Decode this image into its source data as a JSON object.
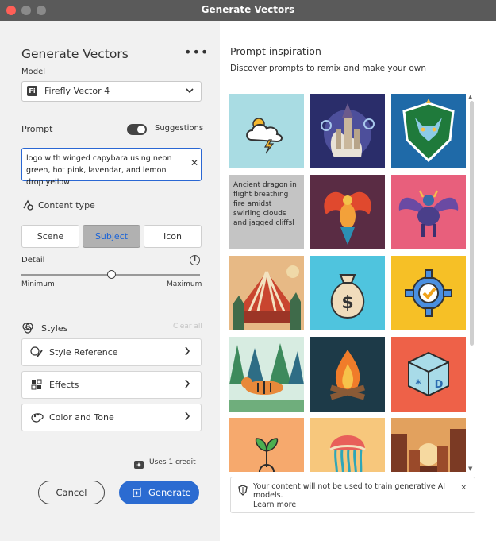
{
  "window": {
    "title": "Generate Vectors"
  },
  "panel": {
    "title": "Generate Vectors",
    "more_label": "•••",
    "model": {
      "label": "Model",
      "badge": "Fi",
      "value": "Firefly Vector 4"
    },
    "prompt": {
      "label": "Prompt",
      "suggestions_label": "Suggestions",
      "suggestions_enabled": true,
      "value": "logo with winged capybara using neon green, hot pink, lavendar, and lemon drop yellow"
    },
    "content_type": {
      "label": "Content type",
      "options": [
        "Scene",
        "Subject",
        "Icon"
      ],
      "selected": "Subject"
    },
    "detail": {
      "label": "Detail",
      "min_label": "Minimum",
      "max_label": "Maximum",
      "value": 0.5
    },
    "styles": {
      "label": "Styles",
      "clear_label": "Clear all",
      "rows": [
        "Style Reference",
        "Effects",
        "Color and Tone"
      ]
    },
    "credit_text": "Uses 1 credit",
    "cancel_label": "Cancel",
    "generate_label": "Generate"
  },
  "inspiration": {
    "title": "Prompt inspiration",
    "subtitle": "Discover prompts to remix and make your own",
    "tiles": [
      {
        "subject": "weather-cloud-sun-lightning-icon",
        "bg": "#a9dce3"
      },
      {
        "subject": "fantasy-castle-illustration",
        "bg": "#2a2d6a"
      },
      {
        "subject": "cat-warrior-shield-logo",
        "bg": "#1f6aa8"
      },
      {
        "subject": "prompt-text",
        "bg": "#c4c4c4",
        "text": "Ancient dragon in flight breathing fire amidst swirling clouds and jagged cliffsl"
      },
      {
        "subject": "phoenix-illustration",
        "bg": "#5a2c44"
      },
      {
        "subject": "winged-bull-illustration",
        "bg": "#e85f7c"
      },
      {
        "subject": "circus-tent-scene",
        "bg": "#e7b985"
      },
      {
        "subject": "money-bag-icon",
        "bg": "#4fc4de"
      },
      {
        "subject": "gear-check-icon",
        "bg": "#f6c026"
      },
      {
        "subject": "tiger-forest-scene",
        "bg": "#d7ece1"
      },
      {
        "subject": "campfire-icon",
        "bg": "#1d3a48"
      },
      {
        "subject": "alphabet-block-icon",
        "bg": "#ee6148"
      },
      {
        "subject": "sprout-icon",
        "bg": "#f6a96d"
      },
      {
        "subject": "jellyfish-illustration",
        "bg": "#f7c77c"
      },
      {
        "subject": "sunset-city-scene",
        "bg": "#c8703c"
      }
    ]
  },
  "notice": {
    "text": "Your content will not be used to train generative AI models.",
    "link": "Learn more",
    "close_label": "×"
  }
}
